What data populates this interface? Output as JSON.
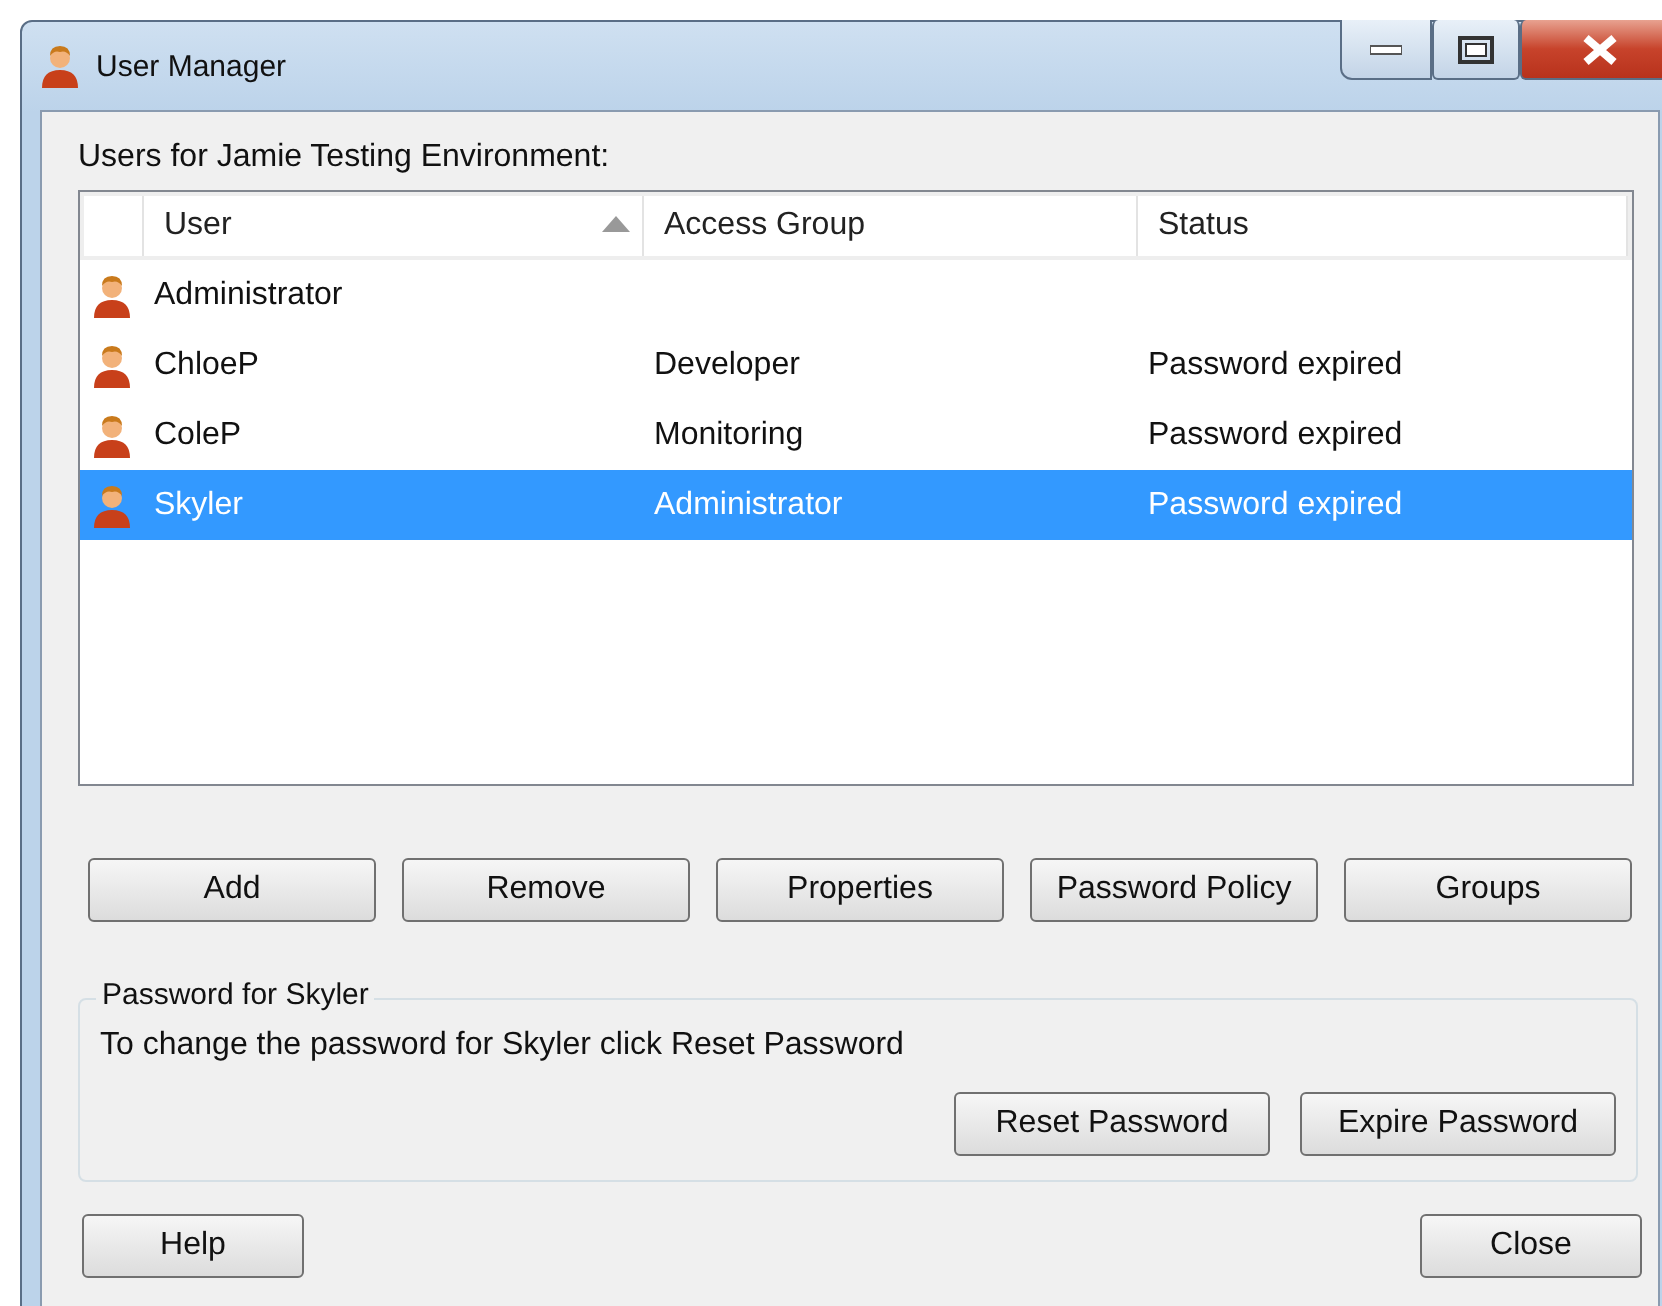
{
  "window": {
    "title": "User Manager"
  },
  "list_label": "Users for Jamie Testing Environment:",
  "table": {
    "columns": [
      {
        "label": "User",
        "sorted": true
      },
      {
        "label": "Access Group",
        "sorted": false
      },
      {
        "label": "Status",
        "sorted": false
      }
    ],
    "rows": [
      {
        "user": "Administrator",
        "selected": false
      },
      {
        "user": "ChloeP",
        "group": "Developer",
        "status": "Password expired",
        "selected": false
      },
      {
        "user": "ColeP",
        "group": "Monitoring",
        "status": "Password expired",
        "selected": false
      },
      {
        "user": "Skyler",
        "group": "Administrator",
        "status": "Password expired",
        "selected": true
      }
    ]
  },
  "buttons": [
    "Add",
    "Remove",
    "Properties",
    "Password Policy",
    "Groups"
  ],
  "password_group": {
    "title": "Password for Skyler",
    "text": "To change the password for Skyler click Reset Password",
    "buttons": [
      "Reset Password",
      "Expire Password"
    ]
  },
  "footer_buttons": [
    "Help",
    "Close"
  ]
}
